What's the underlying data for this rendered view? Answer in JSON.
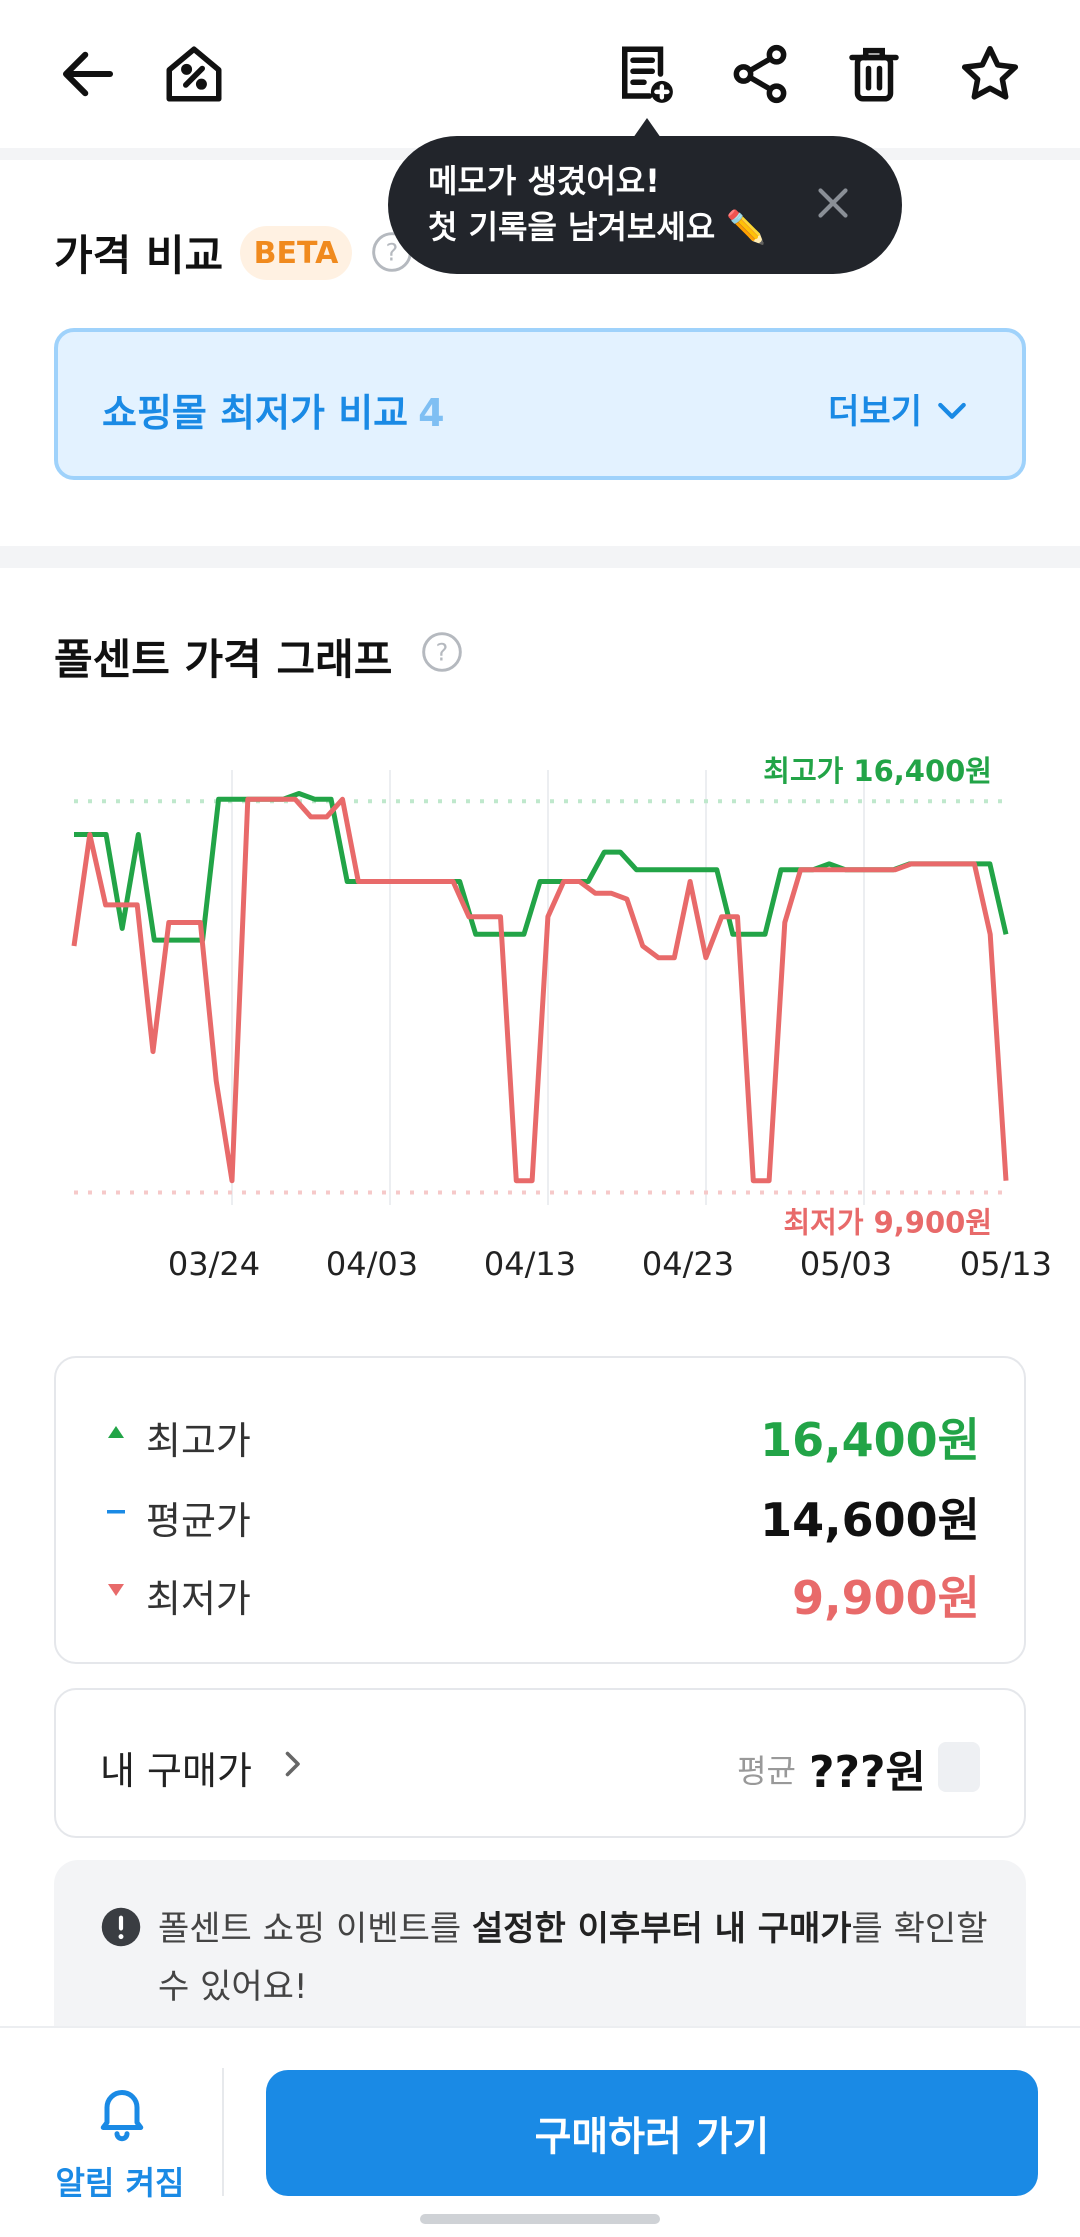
{
  "header": {
    "icons": [
      "back-arrow-icon",
      "home-discount-icon",
      "memo-add-icon",
      "share-icon",
      "trash-icon",
      "star-icon"
    ]
  },
  "tooltip": {
    "line1": "메모가 생겼어요!",
    "line2": "첫 기록을 남겨보세요 ✏️"
  },
  "price_compare": {
    "title": "가격 비교",
    "badge": "BETA",
    "mall_label": "쇼핑몰 최저가 비교",
    "mall_count": "4",
    "more_label": "더보기"
  },
  "graph": {
    "title": "폴센트 가격 그래프"
  },
  "chart_data": {
    "type": "line",
    "x_ticks": [
      "03/24",
      "04/03",
      "04/13",
      "04/23",
      "05/03",
      "05/13"
    ],
    "max_label": "최고가 16,400원",
    "min_label": "최저가 9,900원",
    "ylim": [
      9500,
      17000
    ],
    "max_value": 16400,
    "min_value": 9900,
    "series": [
      {
        "color": "#22a447",
        "values": [
          15900,
          15900,
          15900,
          14300,
          15900,
          14100,
          14100,
          14100,
          14100,
          16500,
          16500,
          16500,
          16500,
          16500,
          16600,
          16500,
          16500,
          15100,
          15100,
          15100,
          15100,
          15100,
          15100,
          15100,
          15100,
          14200,
          14200,
          14200,
          14200,
          15100,
          15100,
          15100,
          15100,
          15600,
          15600,
          15300,
          15300,
          15300,
          15300,
          15300,
          15300,
          14200,
          14200,
          14200,
          15300,
          15300,
          15300,
          15400,
          15300,
          15300,
          15300,
          15300,
          15400,
          15400,
          15400,
          15400,
          15400,
          15400,
          14200
        ]
      },
      {
        "color": "#e86a6a",
        "values": [
          14000,
          15900,
          14700,
          14700,
          14700,
          12200,
          14400,
          14400,
          14400,
          11700,
          10000,
          16500,
          16500,
          16500,
          16500,
          16200,
          16200,
          16500,
          15100,
          15100,
          15100,
          15100,
          15100,
          15100,
          15100,
          14500,
          14500,
          14500,
          10000,
          10000,
          14500,
          15100,
          15100,
          14900,
          14900,
          14800,
          14000,
          13800,
          13800,
          15100,
          13800,
          14500,
          14500,
          10000,
          10000,
          14400,
          15300,
          15300,
          15300,
          15300,
          15300,
          15300,
          15300,
          15400,
          15400,
          15400,
          15400,
          15400,
          14200,
          10000
        ]
      }
    ]
  },
  "stats": {
    "max_label": "최고가",
    "max_value": "16,400원",
    "avg_label": "평균가",
    "avg_value": "14,600원",
    "min_label": "최저가",
    "min_value": "9,900원"
  },
  "my_purchase": {
    "label": "내 구매가",
    "avg_label": "평균",
    "value": "???원"
  },
  "notice": {
    "text_pre": "폴센트 쇼핑 이벤트를 ",
    "text_bold": "설정한 이후부터 내 구매가",
    "text_post": "를 확인할 수 있어요!"
  },
  "bottom": {
    "alarm_label": "알림 켜짐",
    "buy_label": "구매하러 가기"
  },
  "colors": {
    "accent": "#1a8ae5",
    "max_green": "#22a447",
    "min_red": "#e86a6a"
  }
}
